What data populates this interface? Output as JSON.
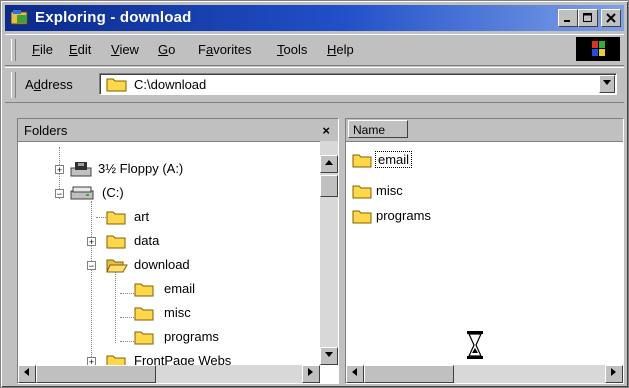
{
  "window": {
    "title": "Exploring - download"
  },
  "menu": [
    {
      "label": "File",
      "u": "F",
      "rest": "ile"
    },
    {
      "label": "Edit",
      "u": "E",
      "rest": "dit"
    },
    {
      "label": "View",
      "u": "V",
      "rest": "iew"
    },
    {
      "label": "Go",
      "u": "G",
      "rest": "o"
    },
    {
      "label": "Favorites",
      "pre": "F",
      "u": "a",
      "rest": "vorites"
    },
    {
      "label": "Tools",
      "u": "T",
      "rest": "ools"
    },
    {
      "label": "Help",
      "u": "H",
      "rest": "elp"
    }
  ],
  "address": {
    "label_pre": "A",
    "label_u": "d",
    "label_rest": "dress",
    "value": "C:\\download"
  },
  "folders_pane": {
    "title": "Folders",
    "close": "×",
    "items": [
      {
        "label": "3½ Floppy (A:)",
        "icon": "floppy-drive-icon",
        "expander": "+"
      },
      {
        "label": "(C:)",
        "icon": "hard-drive-icon",
        "expander": "−"
      },
      {
        "label": "art",
        "icon": "folder-icon"
      },
      {
        "label": "data",
        "icon": "folder-icon",
        "expander": "+"
      },
      {
        "label": "download",
        "icon": "open-folder-icon",
        "expander": "−"
      },
      {
        "label": "email",
        "icon": "folder-icon"
      },
      {
        "label": "misc",
        "icon": "folder-icon"
      },
      {
        "label": "programs",
        "icon": "folder-icon"
      },
      {
        "label": "FrontPage Webs",
        "icon": "folder-icon",
        "expander": "+"
      }
    ]
  },
  "contents_pane": {
    "column": "Name",
    "items": [
      {
        "label": "email"
      },
      {
        "label": "misc"
      },
      {
        "label": "programs"
      }
    ]
  },
  "colors": {
    "title_start": "#0a2a8c",
    "title_end": "#7da2e8",
    "face": "#c0c0c0",
    "folder": "#ffd84a"
  }
}
